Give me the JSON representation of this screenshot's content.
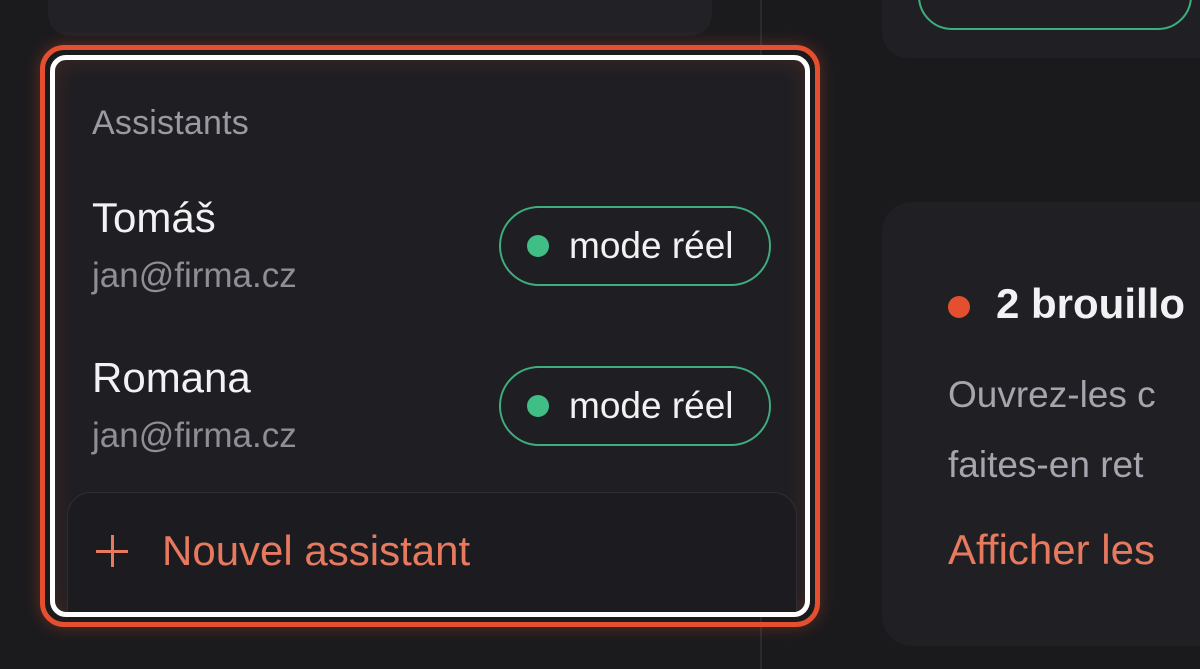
{
  "assistants_panel": {
    "title": "Assistants",
    "items": [
      {
        "name": "Tomáš",
        "email": "jan@firma.cz",
        "mode": "mode réel"
      },
      {
        "name": "Romana",
        "email": "jan@firma.cz",
        "mode": "mode réel"
      }
    ],
    "new_assistant_label": "Nouvel assistant"
  },
  "drafts_card": {
    "title": "2 brouillo",
    "body_lines": [
      "Ouvrez-les c",
      "faites-en ret"
    ],
    "link_label": "Afficher les"
  },
  "colors": {
    "accent": "#e77a5e",
    "highlight": "#e4502f",
    "live_green": "#3fbf86",
    "background": "#1c1c1f"
  }
}
